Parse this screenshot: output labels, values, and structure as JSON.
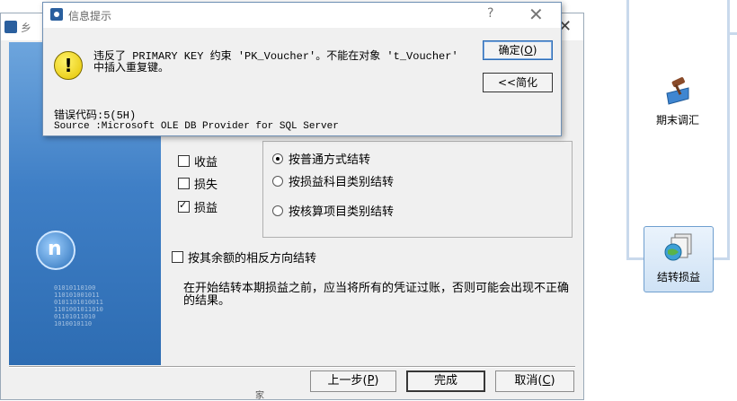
{
  "background": {
    "tools": [
      {
        "label": "期末调汇"
      },
      {
        "label": "结转损益"
      }
    ]
  },
  "wizard": {
    "title_fragment": "乡",
    "accounts": [
      {
        "label": "收益",
        "checked": false
      },
      {
        "label": "损失",
        "checked": false
      },
      {
        "label": "损益",
        "checked": true
      }
    ],
    "methods": [
      {
        "label": "按普通方式结转",
        "selected": true
      },
      {
        "label": "按损益科目类别结转",
        "selected": false
      },
      {
        "label": "按核算项目类别结转",
        "selected": false
      }
    ],
    "reverse_direction_label": "按其余额的相反方向结转",
    "note": "在开始结转本期损益之前，应当将所有的凭证过账，否则可能会出现不正确的结果。",
    "buttons": {
      "prev": "上一步(",
      "prev_key": "P",
      "finish": "完成",
      "cancel": "取消(",
      "cancel_key": "C",
      "close_paren": ")"
    },
    "stray_text": "家"
  },
  "dialog": {
    "title": "信息提示",
    "help": "?",
    "close": "✕",
    "warning_symbol": "!",
    "message": "违反了 PRIMARY KEY 约束 'PK_Voucher'。不能在对象 't_Voucher' 中插入重复键。",
    "ok_button": "确定(",
    "ok_key": "O",
    "simplify_button": "<<简化",
    "error_code": "错误代码:5(5H)",
    "source": "Source  :Microsoft OLE DB Provider for SQL Server"
  },
  "colors": {
    "accent": "#2a5f9e",
    "side_banner": "#3f7fc6",
    "warning": "#e4c300"
  }
}
